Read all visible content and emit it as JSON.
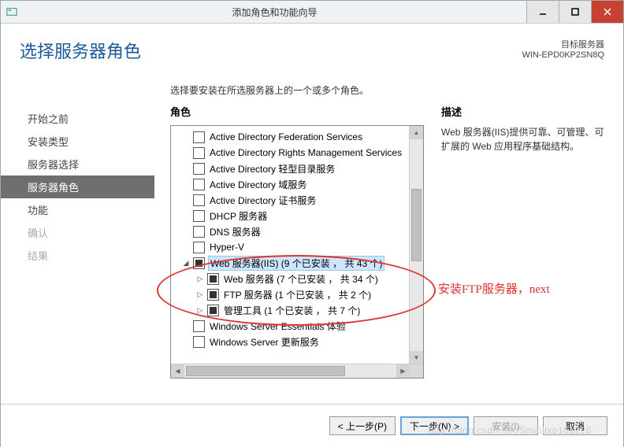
{
  "window": {
    "title": "添加角色和功能向导"
  },
  "header": {
    "title": "选择服务器角色",
    "server_label": "目标服务器",
    "server_name": "WIN-EPD0KP2SN8Q"
  },
  "sidebar": {
    "items": [
      {
        "label": "开始之前",
        "state": "normal"
      },
      {
        "label": "安装类型",
        "state": "normal"
      },
      {
        "label": "服务器选择",
        "state": "normal"
      },
      {
        "label": "服务器角色",
        "state": "selected"
      },
      {
        "label": "功能",
        "state": "normal"
      },
      {
        "label": "确认",
        "state": "disabled"
      },
      {
        "label": "结果",
        "state": "disabled"
      }
    ]
  },
  "main": {
    "intro": "选择要安装在所选服务器上的一个或多个角色。",
    "roles_heading": "角色",
    "desc_heading": "描述",
    "desc_text": "Web 服务器(IIS)提供可靠、可管理、可扩展的 Web 应用程序基础结构。",
    "roles": [
      {
        "label": "Active Directory Federation Services",
        "check": "empty",
        "indent": 0
      },
      {
        "label": "Active Directory Rights Management Services",
        "check": "empty",
        "indent": 0
      },
      {
        "label": "Active Directory 轻型目录服务",
        "check": "empty",
        "indent": 0
      },
      {
        "label": "Active Directory 域服务",
        "check": "empty",
        "indent": 0
      },
      {
        "label": "Active Directory 证书服务",
        "check": "empty",
        "indent": 0
      },
      {
        "label": "DHCP 服务器",
        "check": "empty",
        "indent": 0
      },
      {
        "label": "DNS 服务器",
        "check": "empty",
        "indent": 0
      },
      {
        "label": "Hyper-V",
        "check": "empty",
        "indent": 0
      },
      {
        "label": "Web 服务器(IIS) (9 个已安装 ， 共 43 个)",
        "check": "partial",
        "indent": 0,
        "selected": true,
        "expander": "open"
      },
      {
        "label": "Web 服务器 (7 个已安装 ， 共 34 个)",
        "check": "partial",
        "indent": 1,
        "expander": "closed"
      },
      {
        "label": "FTP 服务器 (1 个已安装 ， 共 2 个)",
        "check": "partial",
        "indent": 1,
        "expander": "closed"
      },
      {
        "label": "管理工具 (1 个已安装 ， 共 7 个)",
        "check": "partial",
        "indent": 1,
        "expander": "closed"
      },
      {
        "label": "Windows Server Essentials 体验",
        "check": "empty",
        "indent": 0
      },
      {
        "label": "Windows Server 更新服务",
        "check": "empty",
        "indent": 0
      }
    ]
  },
  "footer": {
    "prev": "< 上一步(P)",
    "next": "下一步(N) >",
    "install": "安装(I)",
    "cancel": "取消"
  },
  "annotation": {
    "text": "安装FTP服务器，next"
  },
  "watermark": "http://blog.csdn.net/Smalllxp161226"
}
